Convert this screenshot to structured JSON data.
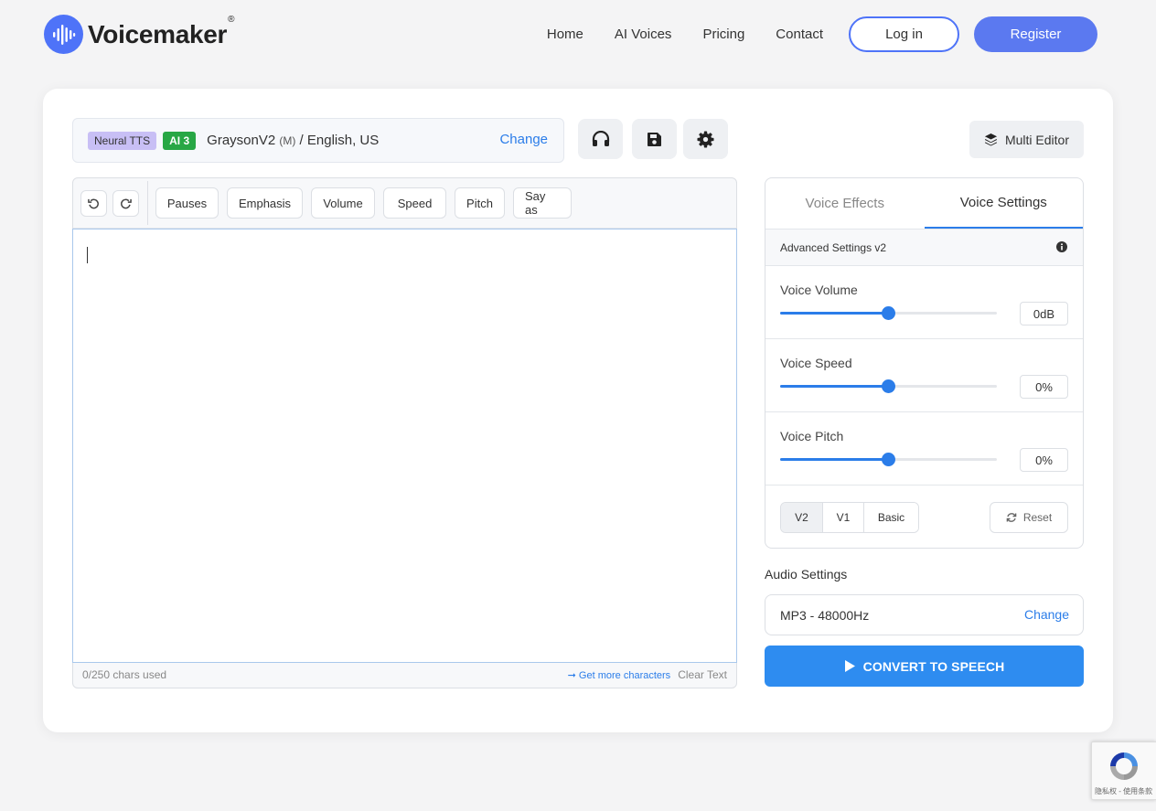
{
  "header": {
    "logo_text": "Voicemaker",
    "logo_reg": "®",
    "nav": [
      "Home",
      "AI Voices",
      "Pricing",
      "Contact"
    ],
    "login_label": "Log in",
    "register_label": "Register"
  },
  "voice": {
    "badge_tts": "Neural TTS",
    "badge_ai": "AI 3",
    "name": "GraysonV2",
    "gender": "(M)",
    "locale": "/ English, US",
    "change_label": "Change"
  },
  "icons": [
    "headphones-icon",
    "save-icon",
    "settings-icon",
    "layers-icon"
  ],
  "multi_editor_label": "Multi Editor",
  "toolbar": {
    "buttons": [
      "Pauses",
      "Emphasis",
      "Volume",
      "Speed",
      "Pitch",
      "Say as"
    ]
  },
  "editor": {
    "text": "",
    "chars_used": "0/250 chars used",
    "get_more": "➞ Get more characters",
    "clear_text": "Clear Text"
  },
  "panel": {
    "tabs": [
      "Voice Effects",
      "Voice Settings"
    ],
    "active_tab": "Voice Settings",
    "advanced_label": "Advanced Settings v2",
    "sliders": [
      {
        "label": "Voice Volume",
        "value": "0dB",
        "level": 0.5
      },
      {
        "label": "Voice Speed",
        "value": "0%",
        "level": 0.5
      },
      {
        "label": "Voice Pitch",
        "value": "0%",
        "level": 0.5
      }
    ],
    "versions": [
      "V2",
      "V1",
      "Basic"
    ],
    "active_version": "V2",
    "reset_label": "Reset"
  },
  "audio": {
    "title": "Audio Settings",
    "format": "MP3 - 48000Hz",
    "change_label": "Change"
  },
  "convert_label": "CONVERT TO SPEECH",
  "recaptcha_text": "隐私权 - 使用条款",
  "colors": {
    "accent": "#2b7de9",
    "brand": "#4e73f8",
    "convert": "#2e8cf0",
    "ai_badge": "#28a745",
    "tts_badge": "#c8bff5"
  }
}
